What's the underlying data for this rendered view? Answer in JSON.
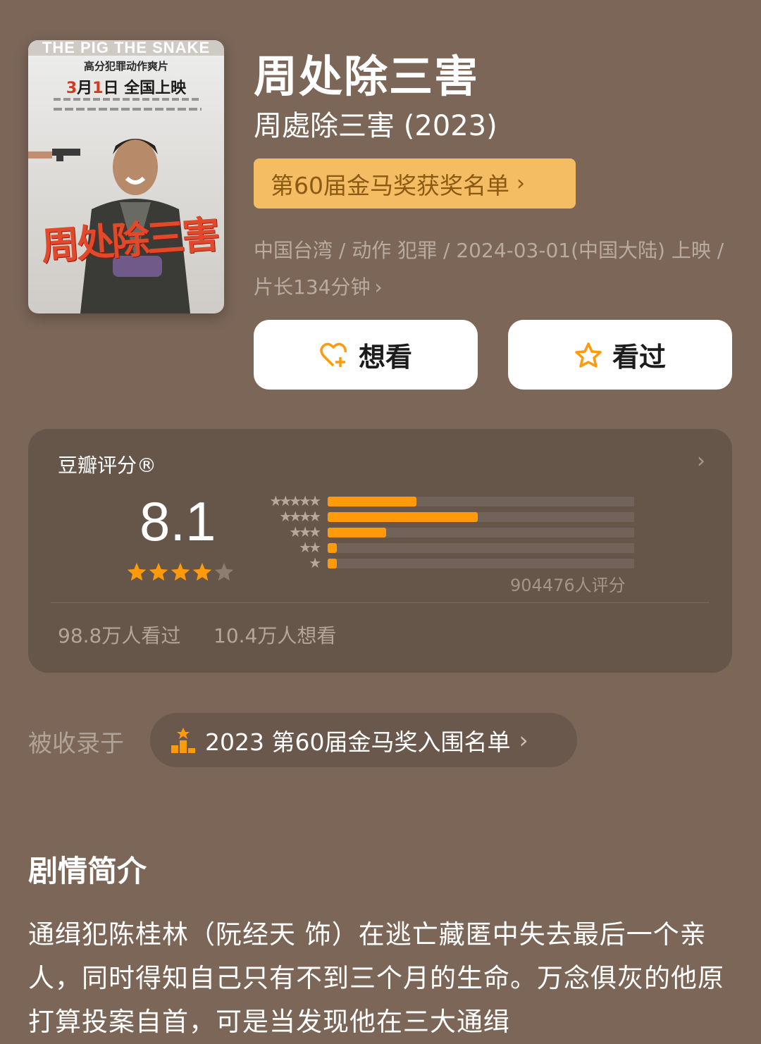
{
  "poster": {
    "top_text": "THE PIG THE SNAKE AND THE PIGEON",
    "genre_line": "高分犯罪动作爽片",
    "date_month": "3",
    "date_mid": "月",
    "date_day": "1",
    "date_rest": "日  全国上映",
    "title_art": "周处除三害"
  },
  "movie": {
    "title": "周处除三害",
    "original_title": "周處除三害 (2023)",
    "award_button": "第60届金马奖获奖名单",
    "meta": "中国台湾 / 动作 犯罪 / 2024-03-01(中国大陆) 上映 / 片长134分钟"
  },
  "actions": {
    "want_label": "想看",
    "seen_label": "看过"
  },
  "rating": {
    "title": "豆瓣评分®",
    "score": "8.1",
    "stars": 4,
    "distribution": [
      {
        "stars": 5,
        "percent": 29
      },
      {
        "stars": 4,
        "percent": 49
      },
      {
        "stars": 3,
        "percent": 19
      },
      {
        "stars": 2,
        "percent": 3
      },
      {
        "stars": 1,
        "percent": 3
      }
    ],
    "count_text": "904476人评分",
    "watched_text": "98.8万人看过",
    "wished_text": "10.4万人想看"
  },
  "included": {
    "label": "被收录于",
    "list_name": "2023 第60届金马奖入围名单"
  },
  "synopsis": {
    "title": "剧情简介",
    "text": "通缉犯陈桂林（阮经天 饰）在逃亡藏匿中失去最后一个亲人，同时得知自己只有不到三个月的生命。万念俱灰的他原打算投案自首，可是当发现他在三大通缉"
  },
  "colors": {
    "background": "#7b6658",
    "card": "#66564a",
    "accent_orange": "#ff9a0a",
    "award_bg": "#f5bd63"
  }
}
